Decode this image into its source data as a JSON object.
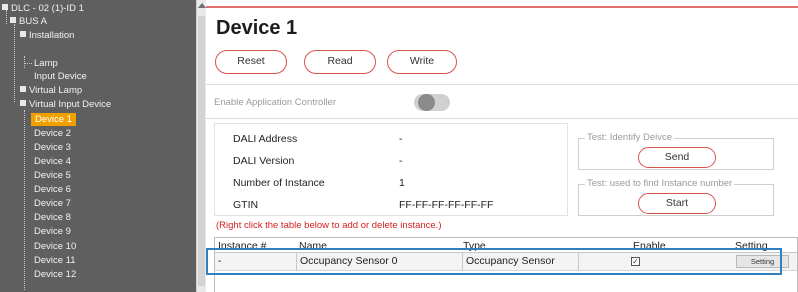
{
  "tree": {
    "root": "DLC - 02 (1)-ID 1",
    "bus": "BUS A",
    "installation": "Installation",
    "lamp": "Lamp",
    "input_device": "Input Device",
    "virtual_lamp": "Virtual Lamp",
    "virtual_input_device": "Virtual Input Device",
    "devices": [
      "Device 1",
      "Device 2",
      "Device 3",
      "Device 4",
      "Device 5",
      "Device 6",
      "Device 7",
      "Device 8",
      "Device 9",
      "Device 10",
      "Device 11",
      "Device 12"
    ],
    "selected": "Device 1"
  },
  "page": {
    "title": "Device 1"
  },
  "buttons": {
    "reset": "Reset",
    "read": "Read",
    "write": "Write"
  },
  "controller": {
    "label": "Enable Application Controller",
    "enabled": false
  },
  "info": {
    "dali_address_label": "DALI Address",
    "dali_address": "-",
    "dali_version_label": "DALI Version",
    "dali_version": "-",
    "instances_label": "Number of Instance",
    "instances": "1",
    "gtin_label": "GTIN",
    "gtin": "FF-FF-FF-FF-FF-FF"
  },
  "identify": {
    "title": "Test: Identify Deivce",
    "button": "Send"
  },
  "find": {
    "title": "Test: used to find Instance number",
    "button": "Start"
  },
  "hint": "(Right click the table below to add or delete instance.)",
  "table": {
    "headers": [
      "Instance #",
      "Name",
      "Type",
      "Enable",
      "Setting"
    ],
    "rows": [
      {
        "instance": "-",
        "name": "Occupancy Sensor 0",
        "type": "Occupancy Sensor",
        "enable": true,
        "setting": "Setting"
      }
    ]
  },
  "colors": {
    "accent": "#d9534f",
    "selection": "#f0a000",
    "highlight": "#2f7fc1",
    "tree_bg": "#5f5f5f"
  }
}
